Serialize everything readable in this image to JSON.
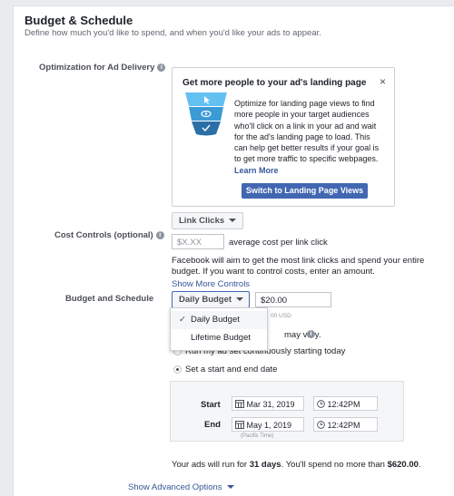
{
  "section": {
    "title": "Budget & Schedule",
    "subtitle": "Define how much you'd like to spend, and when you'd like your ads to appear."
  },
  "optimization": {
    "label": "Optimization for Ad Delivery",
    "card": {
      "title": "Get more people to your ad's landing page",
      "body": "Optimize for landing page views to find more people in your target audiences who'll click on a link in your ad and wait for the ad's landing page to load. This can help get better results if your goal is to get more traffic to specific webpages.",
      "learn_more": "Learn More",
      "button": "Switch to Landing Page Views",
      "close": "×"
    },
    "selected": "Link Clicks"
  },
  "cost_controls": {
    "label": "Cost Controls (optional)",
    "placeholder": "$X.XX",
    "suffix": "average cost per link click",
    "help": "Facebook will aim to get the most link clicks and spend your entire budget. If you want to control costs, enter an amount.",
    "show_more": "Show More Controls"
  },
  "budget": {
    "label": "Budget and Schedule",
    "type": "Daily Budget",
    "amount": "$20.00",
    "currency_note": "00 USD",
    "behind_text": "may vary.",
    "options": [
      "Daily Budget",
      "Lifetime Budget"
    ],
    "checkmark": "✓"
  },
  "schedule": {
    "option_continuous": "Run my ad set continuously starting today",
    "option_dates": "Set a start and end date",
    "start_label": "Start",
    "start_date": "Mar 31, 2019",
    "start_time": "12:42PM",
    "end_label": "End",
    "end_date": "May 1, 2019",
    "end_time": "12:42PM",
    "timezone": "(Pacific Time)"
  },
  "summary": {
    "prefix": "Your ads will run for ",
    "days": "31 days",
    "middle": ". You'll spend no more than ",
    "amount": "$620.00",
    "suffix": "."
  },
  "advanced": {
    "label": "Show Advanced Options"
  },
  "colors": {
    "primary": "#4267b2",
    "link": "#365899",
    "funnel_top": "#62c1f0",
    "funnel_mid": "#3a9bd6",
    "funnel_bottom": "#2b6fa8"
  }
}
